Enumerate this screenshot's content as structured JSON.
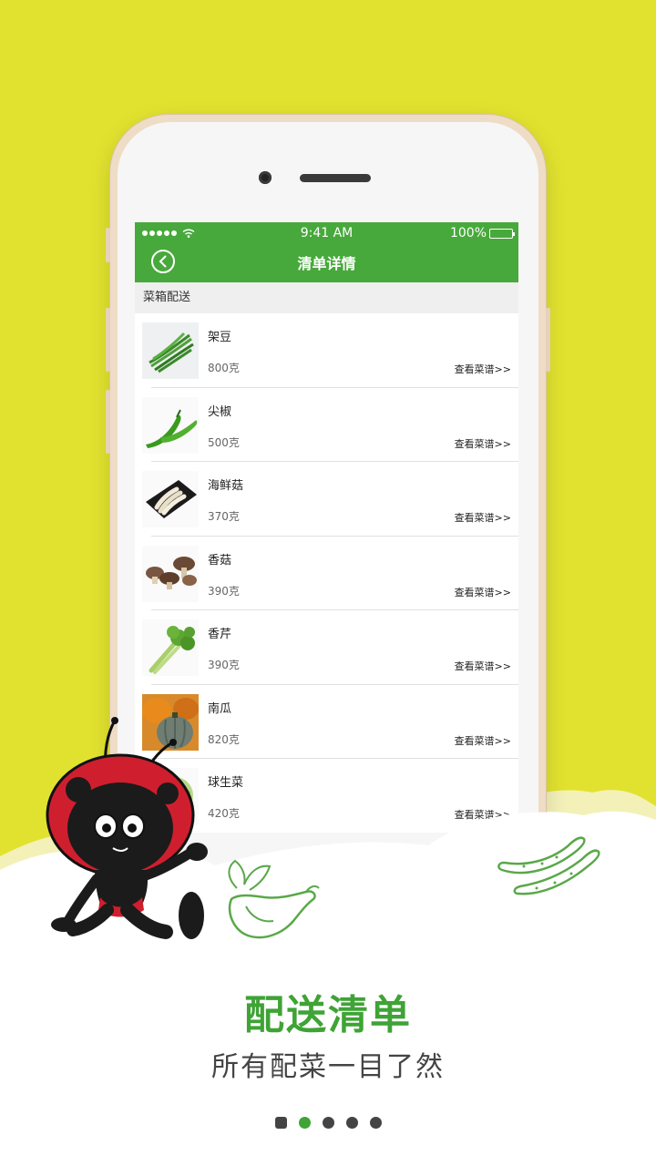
{
  "status": {
    "time": "9:41 AM",
    "battery": "100%"
  },
  "nav": {
    "title": "清单详情"
  },
  "section": {
    "title": "菜箱配送"
  },
  "items": [
    {
      "name": "架豆",
      "weight": "800克",
      "link": "查看菜谱>>"
    },
    {
      "name": "尖椒",
      "weight": "500克",
      "link": "查看菜谱>>"
    },
    {
      "name": "海鲜菇",
      "weight": "370克",
      "link": "查看菜谱>>"
    },
    {
      "name": "香菇",
      "weight": "390克",
      "link": "查看菜谱>>"
    },
    {
      "name": "香芹",
      "weight": "390克",
      "link": "查看菜谱>>"
    },
    {
      "name": "南瓜",
      "weight": "820克",
      "link": "查看菜谱>>"
    },
    {
      "name": "球生菜",
      "weight": "420克",
      "link": "查看菜谱>>"
    }
  ],
  "promo": {
    "headline": "配送清单",
    "subtitle": "所有配菜一目了然"
  },
  "pager": {
    "count": 5,
    "active_index": 1
  },
  "colors": {
    "background": "#e1e22f",
    "brand_green": "#47a93b",
    "headline_green": "#3fa336"
  }
}
